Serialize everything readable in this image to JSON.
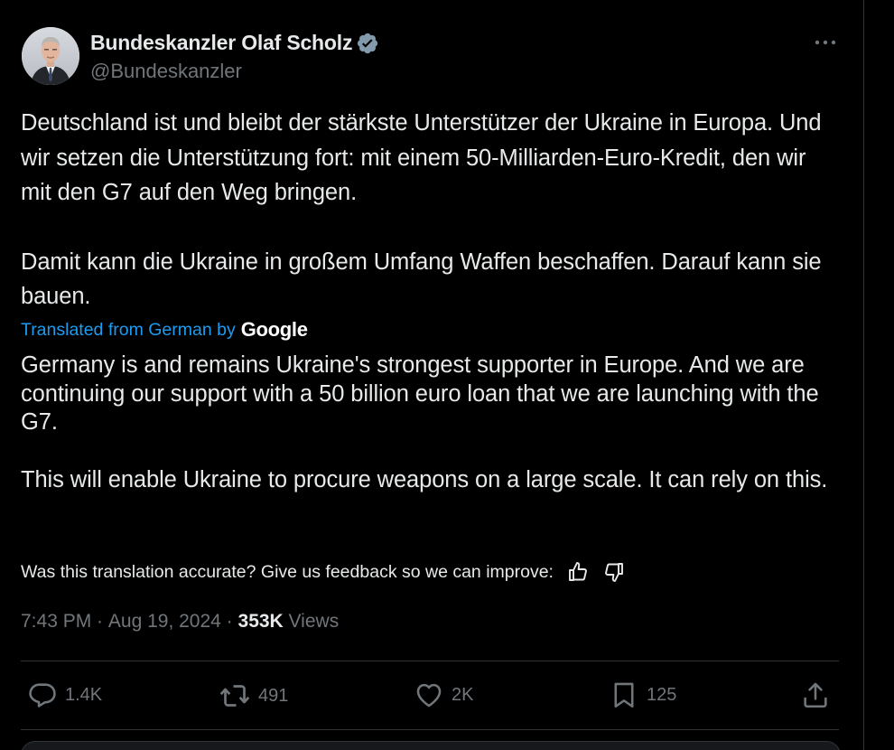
{
  "author": {
    "display_name": "Bundeskanzler Olaf Scholz",
    "handle": "@Bundeskanzler",
    "verified": true
  },
  "tweet": {
    "original_paragraphs": [
      "Deutschland ist und bleibt der stärkste Unterstützer der Ukraine in Europa. Und wir setzen die Unterstützung fort: mit einem 50-Milliarden-Euro-Kredit, den wir mit den G7 auf den Weg bringen.",
      "Damit kann die Ukraine in großem Umfang Waffen beschaffen. Darauf kann sie bauen."
    ],
    "translated_from_label": "Translated from German by",
    "translator_brand": "Google",
    "translation_paragraphs": [
      "Germany is and remains Ukraine's strongest supporter in Europe. And we are continuing our support with a 50 billion euro loan that we are launching with the G7.",
      "This will enable Ukraine to procure weapons on a large scale. It can rely on this."
    ],
    "feedback_prompt": "Was this translation accurate? Give us feedback so we can improve:"
  },
  "meta": {
    "time": "7:43 PM",
    "separator": " · ",
    "date": "Aug 19, 2024",
    "views_count": "353K",
    "views_label": " Views"
  },
  "actions": {
    "replies": "1.4K",
    "reposts": "491",
    "likes": "2K",
    "bookmarks": "125"
  },
  "colors": {
    "background": "#000000",
    "text_primary": "#e7e9ea",
    "text_secondary": "#71767b",
    "link": "#1d9bf0",
    "divider": "#2f3336",
    "verified_badge": "#829aab"
  },
  "icons": {
    "more": "more-horizontal-icon",
    "verified": "verified-badge-icon",
    "thumbs_up": "thumbs-up-icon",
    "thumbs_down": "thumbs-down-icon",
    "reply": "reply-icon",
    "repost": "repost-icon",
    "like": "heart-icon",
    "bookmark": "bookmark-icon",
    "share": "share-icon"
  }
}
